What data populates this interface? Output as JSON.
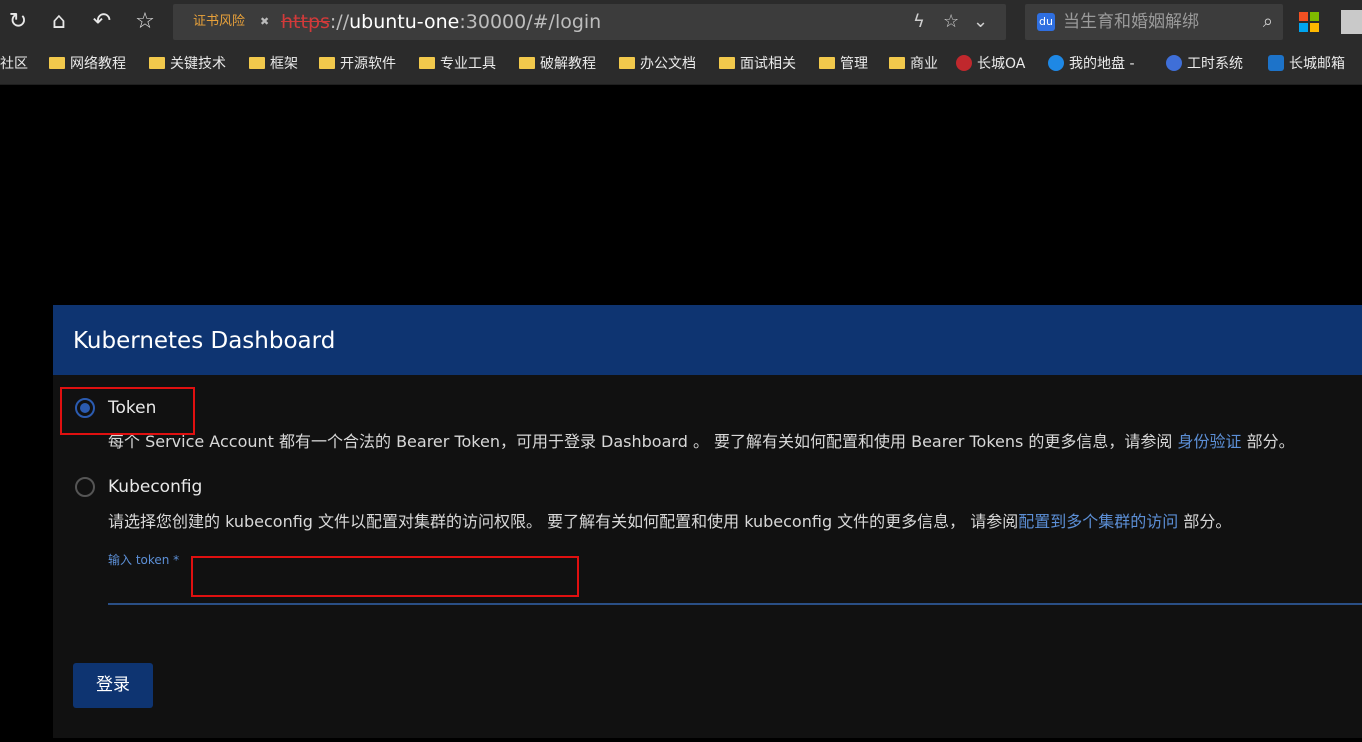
{
  "browser": {
    "cert_warning": "证书风险",
    "url_scheme": "https",
    "url_sep": "://",
    "url_host": "ubuntu-one",
    "url_rest": ":30000/#/login",
    "search_placeholder": "当生育和婚姻解绑",
    "icons": [
      "refresh-icon",
      "home-icon",
      "undo-icon",
      "star-icon",
      "flash-icon",
      "chevron-down-icon",
      "search-icon"
    ]
  },
  "bookmarks": [
    {
      "label": "社区",
      "icon": "none"
    },
    {
      "label": "网络教程",
      "icon": "folder"
    },
    {
      "label": "关键技术",
      "icon": "folder"
    },
    {
      "label": "框架",
      "icon": "folder"
    },
    {
      "label": "开源软件",
      "icon": "folder"
    },
    {
      "label": "专业工具",
      "icon": "folder"
    },
    {
      "label": "破解教程",
      "icon": "folder"
    },
    {
      "label": "办公文档",
      "icon": "folder"
    },
    {
      "label": "面试相关",
      "icon": "folder"
    },
    {
      "label": "管理",
      "icon": "folder"
    },
    {
      "label": "商业",
      "icon": "folder"
    },
    {
      "label": "长城OA",
      "icon": "greatwall"
    },
    {
      "label": "我的地盘 -",
      "icon": "disk"
    },
    {
      "label": "工时系统",
      "icon": "clock"
    },
    {
      "label": "长城邮箱",
      "icon": "mail"
    }
  ],
  "dashboard": {
    "title": "Kubernetes Dashboard",
    "token_option": {
      "label": "Token",
      "selected": true,
      "desc_before": "每个 Service Account 都有一个合法的 Bearer Token，可用于登录 Dashboard 。 要了解有关如何配置和使用 Bearer Tokens 的更多信息，请参阅 ",
      "desc_link": "身份验证",
      "desc_after": " 部分。"
    },
    "kubeconfig_option": {
      "label": "Kubeconfig",
      "selected": false,
      "desc_before": "请选择您创建的 kubeconfig 文件以配置对集群的访问权限。 要了解有关如何配置和使用 kubeconfig 文件的更多信息， 请参阅",
      "desc_link": "配置到多个集群的访问",
      "desc_after": " 部分。"
    },
    "token_field": {
      "label": "输入 token *",
      "value": ""
    },
    "login_button": "登录"
  },
  "colors": {
    "header": "#0e3471",
    "accent": "#2b5bb0",
    "link": "#5c8fd6",
    "highlight": "#e01010"
  }
}
